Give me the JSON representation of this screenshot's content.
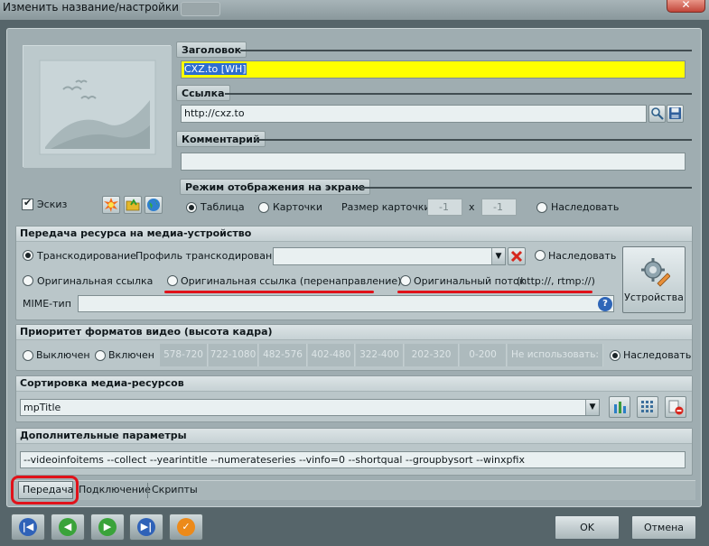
{
  "window": {
    "title": "Изменить название/настройки",
    "close_glyph": "✕"
  },
  "thumbnail": {
    "icon": "picture-placeholder-icon"
  },
  "header_section": {
    "label": "Заголовок",
    "value": "CXZ.to [WH]"
  },
  "link_section": {
    "label": "Ссылка",
    "value": "http://cxz.to"
  },
  "comment_section": {
    "label": "Комментарий",
    "value": ""
  },
  "display_mode": {
    "label": "Режим отображения на экране",
    "options": [
      "Таблица",
      "Карточки",
      "Наследовать"
    ],
    "selected": "Таблица",
    "card_size_label": "Размер карточки",
    "card_w": "-1",
    "card_x": "x",
    "card_h": "-1"
  },
  "sketch": {
    "label": "Эскиз",
    "checked": true
  },
  "transfer": {
    "title": "Передача ресурса на медиа-устройство",
    "transcoding": "Транскодирование",
    "profile_label": "Профиль транскодирования",
    "profile_value": "",
    "inherit": "Наследовать",
    "original_link": "Оригинальная ссылка",
    "original_link_redirect": "Оригинальная ссылка (перенаправление)",
    "original_stream": "Оригинальный поток",
    "original_stream_hint": "(http://, rtmp://)",
    "mime_label": "MIME-тип",
    "mime_value": "",
    "devices_label": "Устройства",
    "selected": "Транскодирование"
  },
  "video_priority": {
    "title": "Приоритет форматов видео (высота кадра)",
    "off": "Выключен",
    "on": "Включен",
    "formats": [
      "578-720",
      "722-1080",
      "482-576",
      "402-480",
      "322-400",
      "202-320",
      "0-200",
      "Не использовать:"
    ],
    "inherit": "Наследовать",
    "selected": "Наследовать"
  },
  "sorting": {
    "title": "Сортировка медиа-ресурсов",
    "value": "mpTitle"
  },
  "extra": {
    "title": "Дополнительные параметры",
    "value": "--videoinfoitems --collect --yearintitle --numerateseries --vinfo=0 --shortqual --groupbysort --winxpfix"
  },
  "tabs": [
    "Передача",
    "Подключение",
    "Скрипты"
  ],
  "footer": {
    "ok": "OK",
    "cancel": "Отмена"
  },
  "colors": {
    "title_highlight": "#ffff00",
    "annotation": "#e0121a",
    "selection": "#2d6dd0"
  }
}
